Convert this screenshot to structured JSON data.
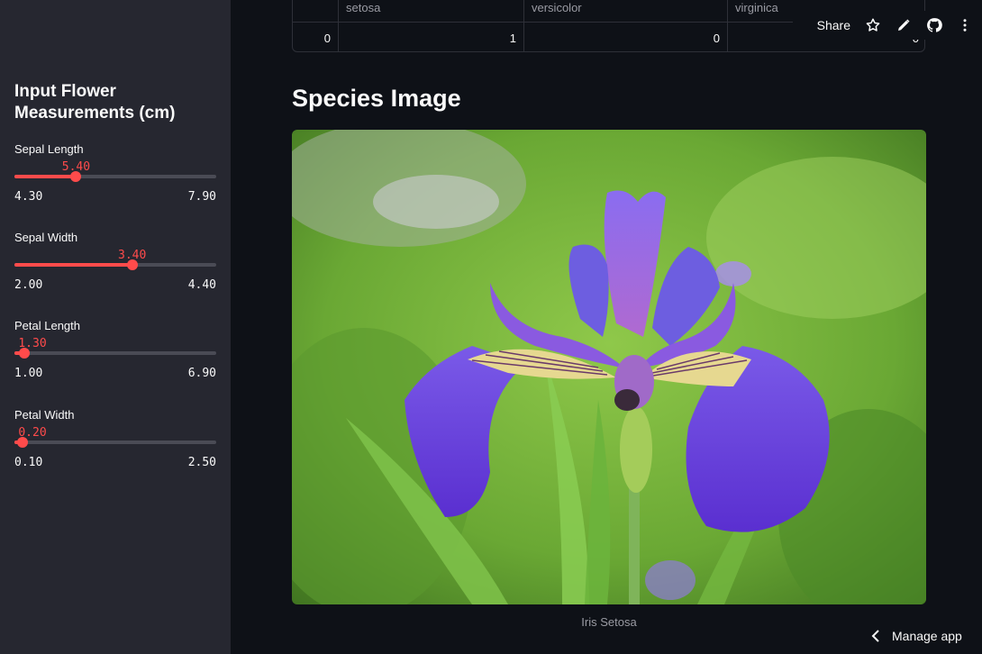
{
  "table": {
    "headers": [
      "",
      "setosa",
      "versicolor",
      "virginica"
    ],
    "row": [
      "0",
      "1",
      "0",
      "0"
    ]
  },
  "toolbar": {
    "share_label": "Share",
    "icons": [
      "star-icon",
      "pencil-icon",
      "github-icon",
      "more-vertical-icon"
    ]
  },
  "sidebar": {
    "title": "Input Flower Measurements (cm)",
    "sliders": [
      {
        "label": "Sepal Length",
        "value": "5.40",
        "min": "4.30",
        "max": "7.90"
      },
      {
        "label": "Sepal Width",
        "value": "3.40",
        "min": "2.00",
        "max": "4.40"
      },
      {
        "label": "Petal Length",
        "value": "1.30",
        "min": "1.00",
        "max": "6.90"
      },
      {
        "label": "Petal Width",
        "value": "0.20",
        "min": "0.10",
        "max": "2.50"
      }
    ]
  },
  "main": {
    "section_title": "Species Image",
    "image_caption": "Iris Setosa"
  },
  "footer": {
    "manage_app_label": "Manage app"
  },
  "colors": {
    "accent": "#ff4b4b",
    "sidebar_bg": "#262730",
    "main_bg": "#0e1117"
  }
}
